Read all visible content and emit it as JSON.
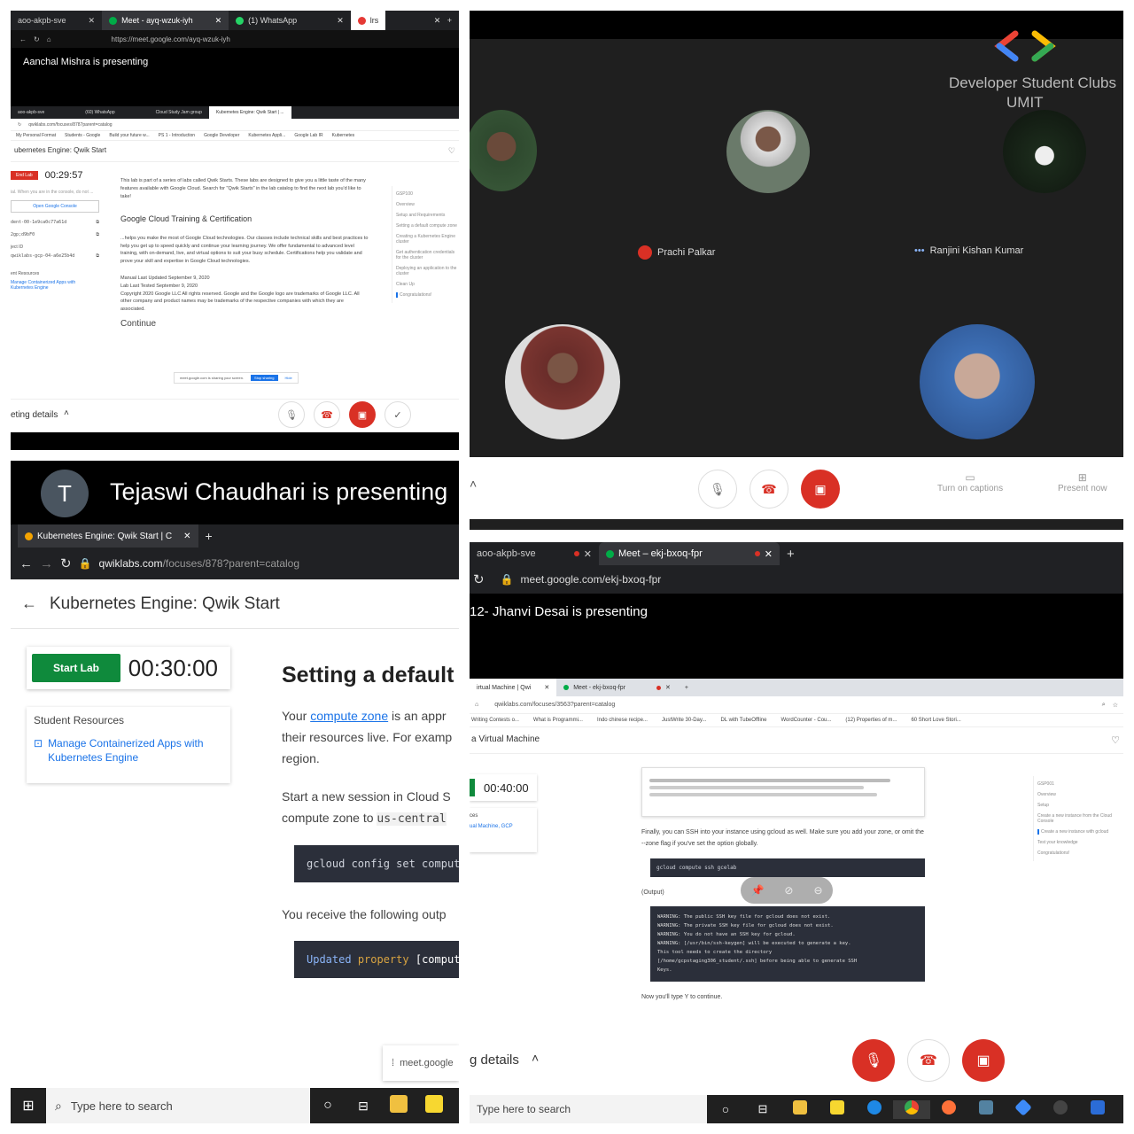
{
  "p1": {
    "tabs": [
      "aoo-akpb-sve",
      "Meet - ayq-wzuk-iyh",
      "(1) WhatsApp",
      "lrs"
    ],
    "url": "https://meet.google.com/ayq-wzuk-iyh",
    "presenting": "Aanchal Mishra is presenting",
    "inner_tabs": [
      "aoo-akpb-sve",
      "(60) WhatsApp",
      "Cloud Study Jam group",
      "Kubernetes Engine: Qwik Start | ..."
    ],
    "inner_url": "qwiklabs.com/focuses/8787parent=catalog",
    "bookmarks": [
      "My Personal Format",
      "Students - Google",
      "Build your future w...",
      "PS 1 - Introduction",
      "Google Developer",
      "Kubernetes Appli...",
      "Google Lab IR",
      "Kubernetes"
    ],
    "lab_title": "ubernetes Engine: Qwik Start",
    "end_lab": "End Lab",
    "timer": "00:29:57",
    "side_note": "ial. When you are in the console, do not ...",
    "open_console": "Open Google Console",
    "cred1": "dent-00-1e9ca0c77a61d",
    "cred2": "2gp;d9bF0",
    "cred3": "qwiklabs-gcp-04-a6e25b4d",
    "label_id": "ject ID",
    "resources_head": "ent Resources",
    "resources_link": "Manage Containerized Apps with Kubernetes Engine",
    "intro": "This lab is part of a series of labs called Qwik Starts. These labs are designed to give you a little taste of the many features available with Google Cloud. Search for \"Qwik Starts\" in the lab catalog to find the next lab you'd like to take!",
    "section_heading": "Google Cloud Training & Certification",
    "section_body": "...helps you make the most of Google Cloud technologies. Our classes include technical skills and best practices to help you get up to speed quickly and continue your learning journey. We offer fundamental to advanced level training, with on-demand, live, and virtual options to suit your busy schedule. Certifications help you validate and prove your skill and expertise in Google Cloud technologies.",
    "manual_updated": "Manual Last Updated September 9, 2020",
    "lab_tested": "Lab Last Tested September 9, 2020",
    "copyright": "Copyright 2020 Google LLC All rights reserved. Google and the Google logo are trademarks of Google LLC. All other company and product names may be trademarks of the respective companies with which they are associated.",
    "continue": "Continue",
    "share_notice": "meet.google.com is sharing your screen.",
    "stop_sharing": "Stop sharing",
    "hide": "Hide",
    "toc": [
      "GSP100",
      "Overview",
      "Setup and Requirements",
      "Setting a default compute zone",
      "Creating a Kubernetes Engine cluster",
      "Get authentication credentials for the cluster",
      "Deploying an application to the cluster",
      "Clean Up",
      "Congratulations!"
    ],
    "meeting_details": "eting details"
  },
  "p2": {
    "brand": "Developer Student Clubs",
    "brand_sub": "UMIT",
    "name1": "Prachi Palkar",
    "name2": "Ranjini Kishan Kumar",
    "captions": "Turn on captions",
    "present_now": "Present now"
  },
  "p3": {
    "avatar_letter": "T",
    "presenting": "Tejaswi Chaudhari is presenting",
    "tab": "Kubernetes Engine: Qwik Start | C",
    "url_host": "qwiklabs.com",
    "url_path": "/focuses/878?parent=catalog",
    "title": "Kubernetes Engine: Qwik Start",
    "start_lab": "Start Lab",
    "timer": "00:30:00",
    "resources": "Student Resources",
    "resource_link": "Manage Containerized Apps with Kubernetes Engine",
    "heading": "Setting a default",
    "p1_a": "Your ",
    "p1_link": "compute zone",
    "p1_b": " is an appr",
    "p1_c": "their resources live. For examp",
    "p1_d": "region.",
    "p2_a": "Start a new session in Cloud S",
    "p2_b": "compute zone to ",
    "p2_code": "us-central",
    "code1": "gcloud config set compute",
    "output_label": "You receive the following outp",
    "code2_a": "Updated",
    "code2_b": "property",
    "code2_c": "[compute",
    "meet_tag": "meet.google",
    "search": "Type here to search"
  },
  "p4": {
    "tabs": [
      "aoo-akpb-sve",
      "Meet – ekj-bxoq-fpr"
    ],
    "url": "meet.google.com/ekj-bxoq-fpr",
    "presenting": "12- Jhanvi Desai is presenting",
    "inner_tabs": [
      "irtual Machine | Qwi",
      "Meet - ekj-bxoq-fpr"
    ],
    "inner_url": "qwiklabs.com/focuses/3563?parent=catalog",
    "bookmarks": [
      "Writing Contests o...",
      "What is Programmi...",
      "Indo chinese recipe...",
      "JustWrite 30-Day...",
      "DL with TubeOffline",
      "WordCounter - Cou...",
      "(12) Properties of m...",
      "60 Short Love Stori..."
    ],
    "lab_title": "a Virtual Machine",
    "timer": "00:40:00",
    "res_a": "ces",
    "res_b": "ual Machine, GCP",
    "para": "Finally, you can SSH into your instance using gcloud as well. Make sure you add your zone, or omit the --zone flag if you've set the option globally.",
    "ssh_cmd": "gcloud compute ssh gcelab",
    "output": "(Output)",
    "out_lines": [
      "WARNING: The public SSH key file for gcloud does not exist.",
      "WARNING: The private SSH key file for gcloud does not exist.",
      "WARNING: You do not have an SSH key for gcloud.",
      "WARNING: [/usr/bin/ssh-keygen] will be executed to generate a key.",
      "This tool needs to create the directory",
      "[/home/gcpstaging306_student/.ssh] before being able to generate SSH",
      "Keys."
    ],
    "now_type": "Now you'll type Y to continue.",
    "toc": [
      "GSP001",
      "Overview",
      "Setup",
      "Create a new instance from the Cloud Console",
      "Create a new instance with gcloud",
      "Test your knowledge",
      "Congratulations!"
    ],
    "meeting_details": "g details",
    "search": "Type here to search"
  }
}
